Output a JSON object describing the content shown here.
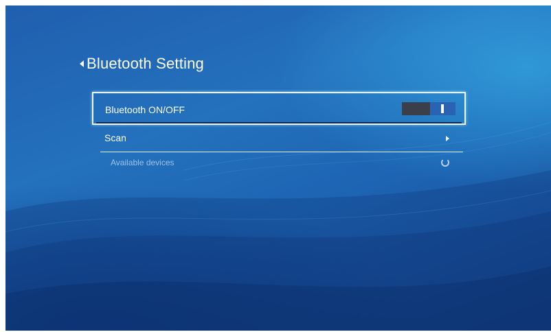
{
  "header": {
    "title": "Bluetooth Setting"
  },
  "settings": {
    "bluetooth": {
      "label": "Bluetooth ON/OFF",
      "state": "on"
    },
    "scan": {
      "label": "Scan"
    },
    "available": {
      "label": "Available devices",
      "status": "searching"
    }
  },
  "icons": {
    "back": "back-arrow-icon",
    "scan": "chevron-right-icon",
    "loading": "loading-spinner-icon"
  },
  "colors": {
    "background_top": "#2471bd",
    "background_bottom": "#163f86",
    "focus_border": "#e9f5ff",
    "toggle_track": "#3a3f49",
    "toggle_thumb": "#2a63b3",
    "section_text": "#9fc3e6"
  }
}
